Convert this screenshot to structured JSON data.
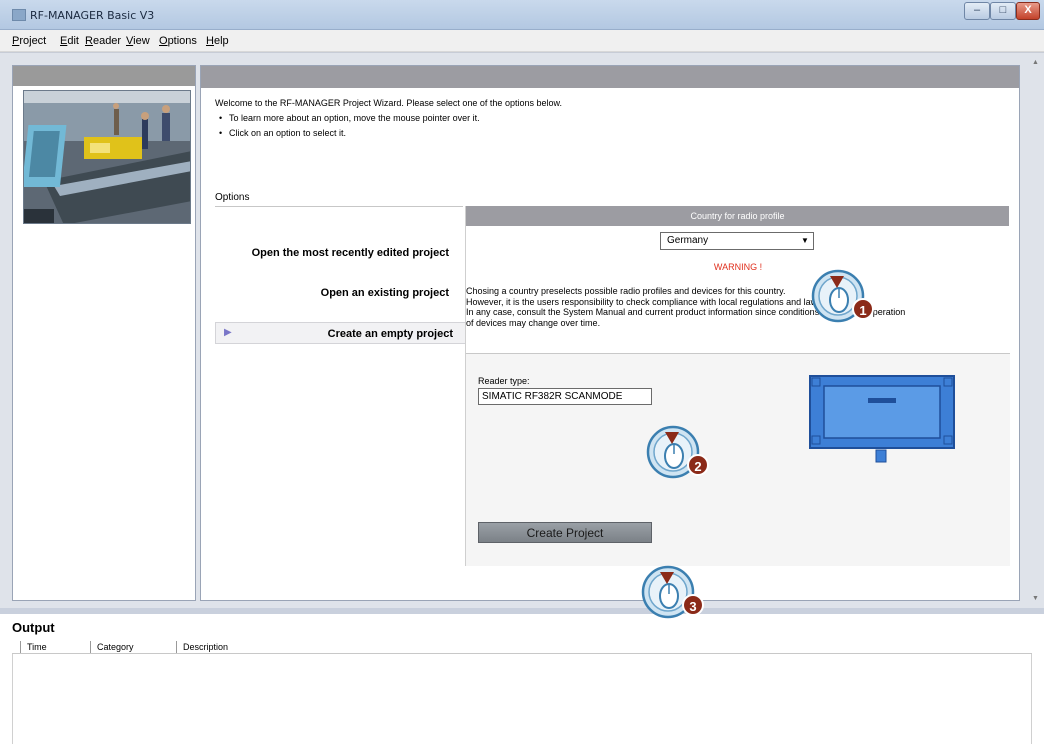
{
  "window": {
    "title": "RF-MANAGER Basic V3",
    "controls": {
      "minimize": "–",
      "maximize": "□",
      "close": "X"
    }
  },
  "menu": [
    {
      "label": "Project",
      "mnemonic": "P",
      "rest": "roject"
    },
    {
      "label": "Edit",
      "mnemonic": "E",
      "rest": "dit"
    },
    {
      "label": "Reader",
      "mnemonic": "R",
      "rest": "eader"
    },
    {
      "label": "View",
      "mnemonic": "V",
      "rest": "iew"
    },
    {
      "label": "Options",
      "mnemonic": "O",
      "rest": "ptions"
    },
    {
      "label": "Help",
      "mnemonic": "H",
      "rest": "elp"
    }
  ],
  "wizard": {
    "intro": "Welcome to the RF-MANAGER Project Wizard. Please select one of the options below.",
    "bullets": [
      "To learn more about an option, move the mouse pointer over it.",
      "Click on an option to select it."
    ],
    "options_label": "Options",
    "options": [
      "Open the most recently edited project",
      "Open an existing project",
      "Create an empty project"
    ],
    "selected_option_index": 2
  },
  "radio_profile": {
    "header": "Country for radio profile",
    "country": "Germany",
    "warning": "WARNING !",
    "info_lines": [
      "Chosing a country preselects possible radio profiles and devices for this country.",
      "However, it is the users responsibility to check compliance with local regulations and laws.",
      "In any case, consult the System Manual and current product information since conditions for allowed operation",
      "of devices may change over time."
    ]
  },
  "reader": {
    "label": "Reader type:",
    "value": "SIMATIC RF382R SCANMODE",
    "create_button": "Create Project"
  },
  "output": {
    "title": "Output",
    "columns": [
      "Time",
      "Category",
      "Description"
    ]
  },
  "callouts": [
    "1",
    "2",
    "3"
  ],
  "colors": {
    "accent_header": "#9c9ca2",
    "warning": "#e0301e",
    "callout_badge": "#8b2a18",
    "device_blue": "#3d7fd6"
  }
}
